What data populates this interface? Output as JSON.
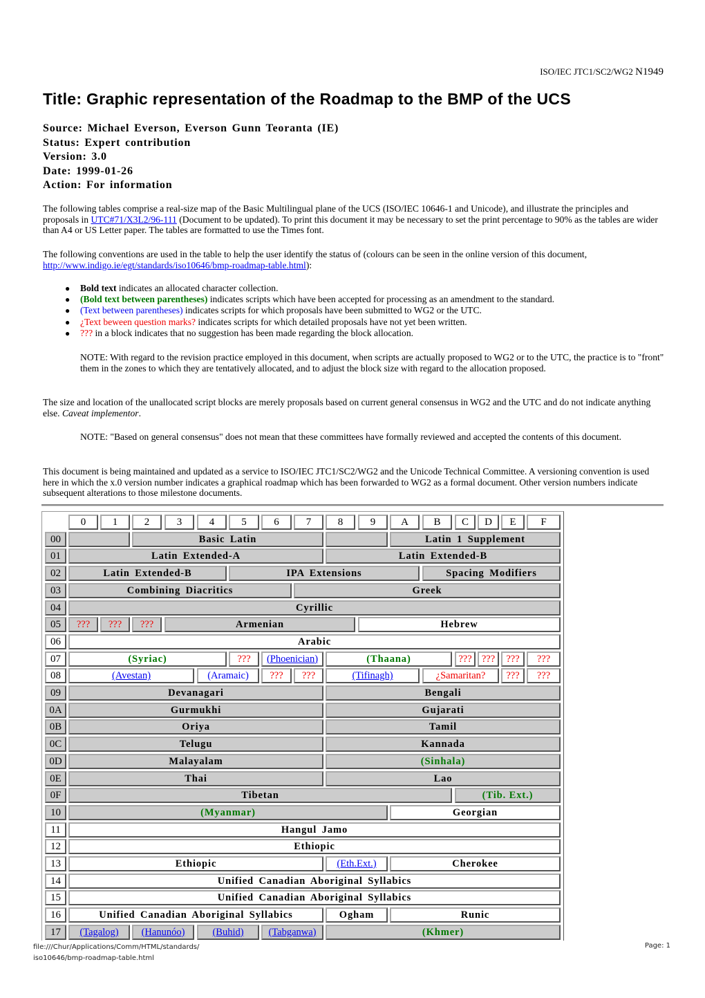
{
  "header": {
    "doc_ref_prefix": "ISO/IEC JTC1/SC2/WG2 ",
    "doc_number": "N1949"
  },
  "title": "Title: Graphic representation of the Roadmap to the BMP of the UCS",
  "meta": {
    "source": "Source: Michael Everson, Everson Gunn Teoranta (IE)",
    "status": "Status: Expert contribution",
    "version": "Version: 3.0",
    "date": "Date: 1999-01-26",
    "action": "Action: For information"
  },
  "intro": {
    "p1_before": "The following tables comprise a real-size map of the Basic Multilingual plane of the UCS (ISO/IEC 10646-1 and Unicode), and illustrate the principles and proposals in ",
    "p1_link": "UTC#71/X3L2/96-111",
    "p1_after": " (Document to be updated). To print this document it may be necessary to set the print percentage to 90% as the tables are wider than A4 or US Letter paper. The tables are formatted to use the Times font.",
    "p2_before": "The following conventions are used in the table to help the user identify the status of (colours can be seen in the online version of this document, ",
    "p2_link": "http://www.indigo.ie/egt/standards/iso10646/bmp-roadmap-table.html",
    "p2_after": "):"
  },
  "legend": [
    {
      "styled": "Bold text",
      "rest": " indicates an allocated character collection.",
      "style": "bold"
    },
    {
      "styled": "(Bold text between parentheses)",
      "rest": " indicates scripts which have been accepted for processing as an amendment to the standard.",
      "style": "green-bold"
    },
    {
      "styled": "(Text between parentheses)",
      "rest": " indicates scripts for which proposals have been submitted to WG2 or the UTC.",
      "style": "blue"
    },
    {
      "styled": "¿Text beween question marks?",
      "rest": " indicates scripts for which detailed proposals have not yet been written.",
      "style": "red"
    },
    {
      "styled": "???",
      "rest": " in a block indicates that no suggestion has been made regarding the block allocation.",
      "style": "red"
    }
  ],
  "bullet_glyph": "●",
  "note1": "NOTE: With regard to the revision practice employed in this document, when scripts are actually proposed to WG2 or to the UTC, the practice is to \"front\" them in the zones to which they are tentatively allocated, and to adjust the block size with regard to the allocation proposed.",
  "para3_before": "The size and location of the unallocated script blocks are merely proposals based on current general consensus in WG2 and the UTC and do not indicate anything else. ",
  "para3_italic": "Caveat implementor",
  "para3_after": ".",
  "note2": "NOTE: \"Based on general consensus\" does not mean that these committees have formally reviewed and accepted the contents of this document.",
  "para4": "This document is being maintained and updated as a service to ISO/IEC JTC1/SC2/WG2 and the Unicode Technical Committee. A versioning convention is used here in which the x.0 version number indicates a graphical roadmap which has been forwarded to WG2 as a formal document. Other version numbers indicate subsequent alterations to those milestone documents.",
  "table": {
    "columns": [
      "0",
      "1",
      "2",
      "3",
      "4",
      "5",
      "6",
      "7",
      "8",
      "9",
      "A",
      "B",
      "C",
      "D",
      "E",
      "F"
    ],
    "rows": [
      {
        "id": "00",
        "bg": "g",
        "cells": [
          {
            "text": "",
            "span": 2,
            "bg": "g"
          },
          {
            "text": "Basic Latin",
            "span": 6,
            "bg": "g",
            "style": "bold"
          },
          {
            "text": "",
            "span": 2,
            "bg": "g"
          },
          {
            "text": "Latin 1 Supplement",
            "span": 6,
            "bg": "g",
            "style": "bold"
          }
        ]
      },
      {
        "id": "01",
        "bg": "g",
        "cells": [
          {
            "text": "Latin Extended-A",
            "span": 8,
            "bg": "g",
            "style": "bold"
          },
          {
            "text": "Latin Extended-B",
            "span": 8,
            "bg": "g",
            "style": "bold"
          }
        ]
      },
      {
        "id": "02",
        "bg": "g",
        "cells": [
          {
            "text": "Latin Extended-B",
            "span": 5,
            "bg": "g",
            "style": "bold"
          },
          {
            "text": "IPA Extensions",
            "span": 6,
            "bg": "g",
            "style": "bold"
          },
          {
            "text": "Spacing Modifiers",
            "span": 5,
            "bg": "g",
            "style": "bold"
          }
        ]
      },
      {
        "id": "03",
        "bg": "g",
        "cells": [
          {
            "text": "Combining Diacritics",
            "span": 7,
            "bg": "g",
            "style": "bold"
          },
          {
            "text": "Greek",
            "span": 9,
            "bg": "g",
            "style": "bold"
          }
        ]
      },
      {
        "id": "04",
        "bg": "g",
        "cells": [
          {
            "text": "Cyrillic",
            "span": 16,
            "bg": "g",
            "style": "bold"
          }
        ]
      },
      {
        "id": "05",
        "bg": "g",
        "cells": [
          {
            "text": "???",
            "span": 1,
            "bg": "g",
            "style": "red"
          },
          {
            "text": "???",
            "span": 1,
            "bg": "g",
            "style": "red"
          },
          {
            "text": "???",
            "span": 1,
            "bg": "g",
            "style": "red"
          },
          {
            "text": "Armenian",
            "span": 6,
            "bg": "g",
            "style": "bold"
          },
          {
            "text": "Hebrew",
            "span": 7,
            "bg": "w",
            "style": "bold"
          }
        ]
      },
      {
        "id": "06",
        "bg": "w",
        "cells": [
          {
            "text": "Arabic",
            "span": 16,
            "bg": "w",
            "style": "bold"
          }
        ]
      },
      {
        "id": "07",
        "bg": "w",
        "cells": [
          {
            "text": "(Syriac)",
            "span": 5,
            "bg": "w",
            "style": "green"
          },
          {
            "text": "???",
            "span": 1,
            "bg": "w",
            "style": "red"
          },
          {
            "text": "(Phoenician)",
            "span": 2,
            "bg": "w",
            "style": "link"
          },
          {
            "text": "(Thaana)",
            "span": 4,
            "bg": "w",
            "style": "green"
          },
          {
            "text": "???",
            "span": 1,
            "bg": "w",
            "style": "red"
          },
          {
            "text": "???",
            "span": 1,
            "bg": "w",
            "style": "red"
          },
          {
            "text": "???",
            "span": 1,
            "bg": "w",
            "style": "red"
          },
          {
            "text": "???",
            "span": 1,
            "bg": "w",
            "style": "red"
          }
        ]
      },
      {
        "id": "08",
        "bg": "w",
        "cells": [
          {
            "text": "(Avestan)",
            "span": 4,
            "bg": "w",
            "style": "link"
          },
          {
            "text": "(Aramaic)",
            "span": 2,
            "bg": "w",
            "style": "blue"
          },
          {
            "text": "???",
            "span": 1,
            "bg": "w",
            "style": "red"
          },
          {
            "text": "???",
            "span": 1,
            "bg": "w",
            "style": "red"
          },
          {
            "text": "(Tifinagh)",
            "span": 3,
            "bg": "w",
            "style": "link"
          },
          {
            "text": "¿Samaritan?",
            "span": 3,
            "bg": "w",
            "style": "red"
          },
          {
            "text": "???",
            "span": 1,
            "bg": "w",
            "style": "red"
          },
          {
            "text": "???",
            "span": 1,
            "bg": "w",
            "style": "red"
          }
        ]
      },
      {
        "id": "09",
        "bg": "g",
        "cells": [
          {
            "text": "Devanagari",
            "span": 8,
            "bg": "g",
            "style": "bold"
          },
          {
            "text": "Bengali",
            "span": 8,
            "bg": "g",
            "style": "bold"
          }
        ]
      },
      {
        "id": "0A",
        "bg": "g",
        "cells": [
          {
            "text": "Gurmukhi",
            "span": 8,
            "bg": "g",
            "style": "bold"
          },
          {
            "text": "Gujarati",
            "span": 8,
            "bg": "g",
            "style": "bold"
          }
        ]
      },
      {
        "id": "0B",
        "bg": "g",
        "cells": [
          {
            "text": "Oriya",
            "span": 8,
            "bg": "g",
            "style": "bold"
          },
          {
            "text": "Tamil",
            "span": 8,
            "bg": "g",
            "style": "bold"
          }
        ]
      },
      {
        "id": "0C",
        "bg": "g",
        "cells": [
          {
            "text": "Telugu",
            "span": 8,
            "bg": "g",
            "style": "bold"
          },
          {
            "text": "Kannada",
            "span": 8,
            "bg": "g",
            "style": "bold"
          }
        ]
      },
      {
        "id": "0D",
        "bg": "g",
        "cells": [
          {
            "text": "Malayalam",
            "span": 8,
            "bg": "g",
            "style": "bold"
          },
          {
            "text": "(Sinhala)",
            "span": 8,
            "bg": "g",
            "style": "green"
          }
        ]
      },
      {
        "id": "0E",
        "bg": "g",
        "cells": [
          {
            "text": "Thai",
            "span": 8,
            "bg": "g",
            "style": "bold"
          },
          {
            "text": "Lao",
            "span": 8,
            "bg": "g",
            "style": "bold"
          }
        ]
      },
      {
        "id": "0F",
        "bg": "g",
        "cells": [
          {
            "text": "Tibetan",
            "span": 12,
            "bg": "g",
            "style": "bold"
          },
          {
            "text": "(Tib. Ext.)",
            "span": 4,
            "bg": "g",
            "style": "green"
          }
        ]
      },
      {
        "id": "10",
        "bg": "g",
        "cells": [
          {
            "text": "(Myanmar)",
            "span": 10,
            "bg": "g",
            "style": "green"
          },
          {
            "text": "Georgian",
            "span": 6,
            "bg": "w",
            "style": "bold"
          }
        ]
      },
      {
        "id": "11",
        "bg": "w",
        "cells": [
          {
            "text": "Hangul Jamo",
            "span": 16,
            "bg": "w",
            "style": "bold"
          }
        ]
      },
      {
        "id": "12",
        "bg": "w",
        "cells": [
          {
            "text": "Ethiopic",
            "span": 16,
            "bg": "w",
            "style": "bold"
          }
        ]
      },
      {
        "id": "13",
        "bg": "w",
        "cells": [
          {
            "text": "Ethiopic",
            "span": 8,
            "bg": "w",
            "style": "bold"
          },
          {
            "text": "(Eth.Ext.)",
            "span": 2,
            "bg": "w",
            "style": "link"
          },
          {
            "text": "Cherokee",
            "span": 6,
            "bg": "w",
            "style": "bold"
          }
        ]
      },
      {
        "id": "14",
        "bg": "w",
        "cells": [
          {
            "text": "Unified Canadian Aboriginal Syllabics",
            "span": 16,
            "bg": "w",
            "style": "bold"
          }
        ]
      },
      {
        "id": "15",
        "bg": "w",
        "cells": [
          {
            "text": "Unified Canadian Aboriginal Syllabics",
            "span": 16,
            "bg": "w",
            "style": "bold"
          }
        ]
      },
      {
        "id": "16",
        "bg": "w",
        "cells": [
          {
            "text": "Unified Canadian Aboriginal Syllabics",
            "span": 8,
            "bg": "w",
            "style": "bold"
          },
          {
            "text": "Ogham",
            "span": 2,
            "bg": "w",
            "style": "bold"
          },
          {
            "text": "Runic",
            "span": 6,
            "bg": "w",
            "style": "bold"
          }
        ]
      },
      {
        "id": "17",
        "bg": "g",
        "cells": [
          {
            "text": "(Tagalog)",
            "span": 2,
            "bg": "g",
            "style": "link"
          },
          {
            "text": "(Hanunóo)",
            "span": 2,
            "bg": "g",
            "style": "link"
          },
          {
            "text": "(Buhid)",
            "span": 2,
            "bg": "g",
            "style": "link"
          },
          {
            "text": "(Tabganwa)",
            "span": 2,
            "bg": "g",
            "style": "link"
          },
          {
            "text": "(Khmer)",
            "span": 8,
            "bg": "g",
            "style": "green"
          }
        ]
      }
    ]
  },
  "footer": {
    "path_line1": "file:///Chur/Applications/Comm/HTML/standards/",
    "path_line2": "iso10646/bmp-roadmap-table.html",
    "page": "Page: 1"
  }
}
